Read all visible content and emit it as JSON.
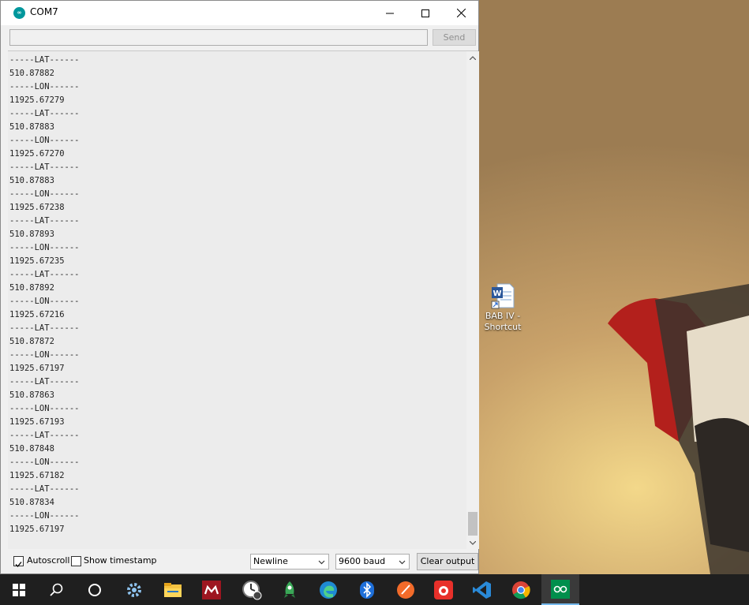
{
  "window": {
    "title": "COM7",
    "icon": "arduino-icon"
  },
  "send_bar": {
    "input_value": "",
    "send_label": "Send"
  },
  "output_lines": [
    "-----LAT------",
    "510.87882",
    "-----LON------",
    "11925.67279",
    "-----LAT------",
    "510.87883",
    "-----LON------",
    "11925.67270",
    "-----LAT------",
    "510.87883",
    "-----LON------",
    "11925.67238",
    "-----LAT------",
    "510.87893",
    "-----LON------",
    "11925.67235",
    "-----LAT------",
    "510.87892",
    "-----LON------",
    "11925.67216",
    "-----LAT------",
    "510.87872",
    "-----LON------",
    "11925.67197",
    "-----LAT------",
    "510.87863",
    "-----LON------",
    "11925.67193",
    "-----LAT------",
    "510.87848",
    "-----LON------",
    "11925.67182",
    "-----LAT------",
    "510.87834",
    "-----LON------",
    "11925.67197"
  ],
  "bottom_bar": {
    "autoscroll_label": "Autoscroll",
    "autoscroll_checked": true,
    "timestamp_label": "Show timestamp",
    "timestamp_checked": false,
    "line_ending": "Newline",
    "baud_rate": "9600 baud",
    "clear_label": "Clear output"
  },
  "desktop_icon": {
    "label_line1": "BAB IV -",
    "label_line2": "Shortcut",
    "icon": "word-document-icon"
  },
  "taskbar": {
    "items": [
      "windows-start-icon",
      "search-icon",
      "cortana-icon",
      "settings-gear-icon",
      "file-explorer-icon",
      "mendeley-icon",
      "clock-app-icon",
      "rocket-app-icon",
      "edge-icon",
      "bluetooth-icon",
      "swift-app-icon",
      "screenshot-app-icon",
      "vscode-icon",
      "chrome-icon",
      "arduino-icon"
    ]
  },
  "colors": {
    "arduino_teal": "#00979c",
    "taskbar_bg": "#1f1f1f",
    "wallpaper_tan": "#a98a5e"
  }
}
